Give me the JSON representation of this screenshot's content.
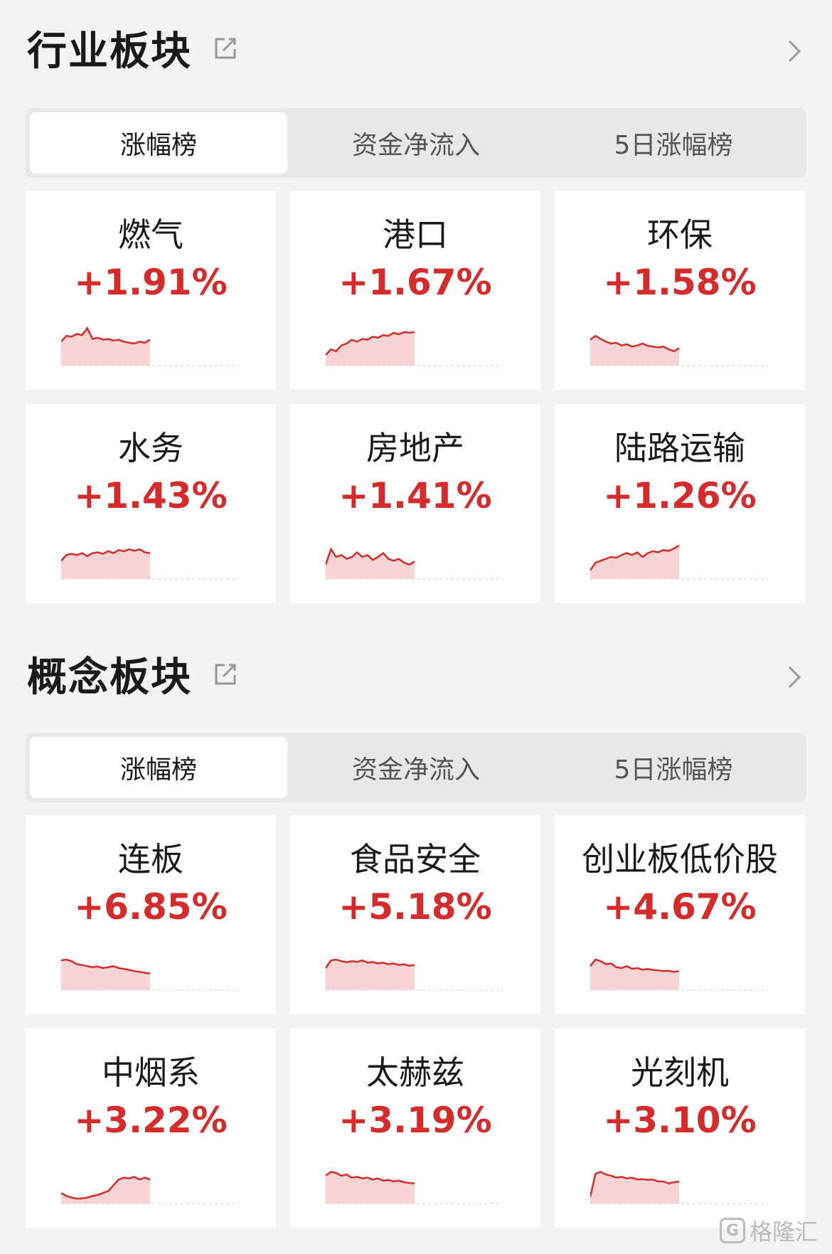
{
  "colors": {
    "up": "#d52b2b",
    "fill": "#f6c9c9"
  },
  "sections": [
    {
      "title": "行业板块",
      "tabs": [
        "涨幅榜",
        "资金净流入",
        "5日涨幅榜"
      ],
      "cards": [
        {
          "name": "燃气",
          "change": "+1.91%",
          "spark": [
            0.55,
            0.7,
            0.68,
            0.75,
            0.72,
            0.9,
            0.62,
            0.65,
            0.6,
            0.62,
            0.58,
            0.6,
            0.55,
            0.52,
            0.5,
            0.55,
            0.52,
            0.6
          ]
        },
        {
          "name": "港口",
          "change": "+1.67%",
          "spark": [
            0.2,
            0.35,
            0.3,
            0.45,
            0.5,
            0.6,
            0.55,
            0.62,
            0.6,
            0.68,
            0.65,
            0.72,
            0.7,
            0.78,
            0.74,
            0.8,
            0.78,
            0.8
          ]
        },
        {
          "name": "环保",
          "change": "+1.58%",
          "spark": [
            0.6,
            0.7,
            0.62,
            0.55,
            0.5,
            0.52,
            0.45,
            0.48,
            0.42,
            0.45,
            0.5,
            0.44,
            0.42,
            0.4,
            0.42,
            0.35,
            0.3,
            0.38
          ]
        },
        {
          "name": "水务",
          "change": "+1.43%",
          "spark": [
            0.4,
            0.55,
            0.58,
            0.55,
            0.6,
            0.52,
            0.6,
            0.62,
            0.58,
            0.65,
            0.6,
            0.68,
            0.65,
            0.7,
            0.66,
            0.7,
            0.62,
            0.6
          ]
        },
        {
          "name": "房地产",
          "change": "+1.41%",
          "spark": [
            0.3,
            0.7,
            0.5,
            0.55,
            0.45,
            0.5,
            0.62,
            0.5,
            0.55,
            0.42,
            0.5,
            0.6,
            0.45,
            0.4,
            0.45,
            0.35,
            0.3,
            0.38
          ]
        },
        {
          "name": "陆路运输",
          "change": "+1.26%",
          "spark": [
            0.15,
            0.35,
            0.4,
            0.45,
            0.5,
            0.48,
            0.55,
            0.6,
            0.55,
            0.62,
            0.5,
            0.6,
            0.65,
            0.62,
            0.68,
            0.66,
            0.72,
            0.8
          ]
        }
      ]
    },
    {
      "title": "概念板块",
      "tabs": [
        "涨幅榜",
        "资金净流入",
        "5日涨幅榜"
      ],
      "cards": [
        {
          "name": "连板",
          "change": "+6.85%",
          "spark": [
            0.7,
            0.72,
            0.68,
            0.6,
            0.58,
            0.55,
            0.52,
            0.54,
            0.5,
            0.52,
            0.55,
            0.5,
            0.48,
            0.45,
            0.42,
            0.4,
            0.38,
            0.36
          ]
        },
        {
          "name": "食品安全",
          "change": "+5.18%",
          "spark": [
            0.5,
            0.7,
            0.72,
            0.68,
            0.65,
            0.68,
            0.66,
            0.7,
            0.64,
            0.66,
            0.62,
            0.64,
            0.6,
            0.62,
            0.58,
            0.6,
            0.56,
            0.58
          ]
        },
        {
          "name": "创业板低价股",
          "change": "+4.67%",
          "spark": [
            0.55,
            0.72,
            0.68,
            0.6,
            0.62,
            0.52,
            0.5,
            0.55,
            0.48,
            0.5,
            0.46,
            0.48,
            0.45,
            0.44,
            0.42,
            0.43,
            0.4,
            0.42
          ]
        },
        {
          "name": "中烟系",
          "change": "+3.22%",
          "spark": [
            0.2,
            0.12,
            0.08,
            0.05,
            0.06,
            0.08,
            0.12,
            0.15,
            0.2,
            0.25,
            0.4,
            0.55,
            0.6,
            0.58,
            0.62,
            0.55,
            0.6,
            0.55
          ]
        },
        {
          "name": "太赫兹",
          "change": "+3.19%",
          "spark": [
            0.65,
            0.75,
            0.72,
            0.65,
            0.68,
            0.6,
            0.62,
            0.58,
            0.6,
            0.55,
            0.58,
            0.52,
            0.54,
            0.5,
            0.52,
            0.48,
            0.46,
            0.45
          ]
        },
        {
          "name": "光刻机",
          "change": "+3.10%",
          "spark": [
            0.1,
            0.7,
            0.75,
            0.68,
            0.65,
            0.6,
            0.62,
            0.58,
            0.6,
            0.55,
            0.56,
            0.54,
            0.55,
            0.5,
            0.5,
            0.45,
            0.48,
            0.5
          ]
        }
      ]
    }
  ],
  "watermark": "格隆汇"
}
